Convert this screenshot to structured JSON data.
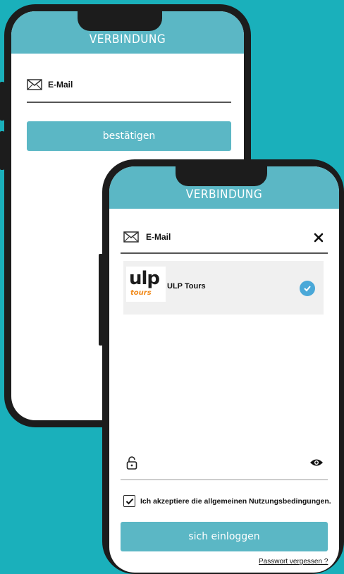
{
  "back_screen": {
    "header_title": "VERBINDUNG",
    "email_label": "E-Mail",
    "confirm_button": "bestätigen",
    "icons": {
      "mail": "mail-icon"
    }
  },
  "front_screen": {
    "header_title": "VERBINDUNG",
    "email_label": "E-Mail",
    "account": {
      "name": "ULP Tours",
      "logo_top": "ulp",
      "logo_bottom": "tours",
      "selected": true
    },
    "terms_label": "Ich akzeptiere die allgemeinen Nutzungsbedingungen.",
    "terms_checked": true,
    "login_button": "sich einloggen",
    "forgot_link": "Passwort vergessen ?",
    "icons": {
      "mail": "mail-icon",
      "clear": "close-icon",
      "lock": "lock-icon",
      "reveal": "eye-icon",
      "check": "check-icon"
    }
  },
  "colors": {
    "background": "#1ab0bb",
    "accent": "#5bb7c5",
    "frame": "#1c1c1c",
    "check_blue": "#4aa8d8",
    "logo_orange": "#f08a1c"
  }
}
